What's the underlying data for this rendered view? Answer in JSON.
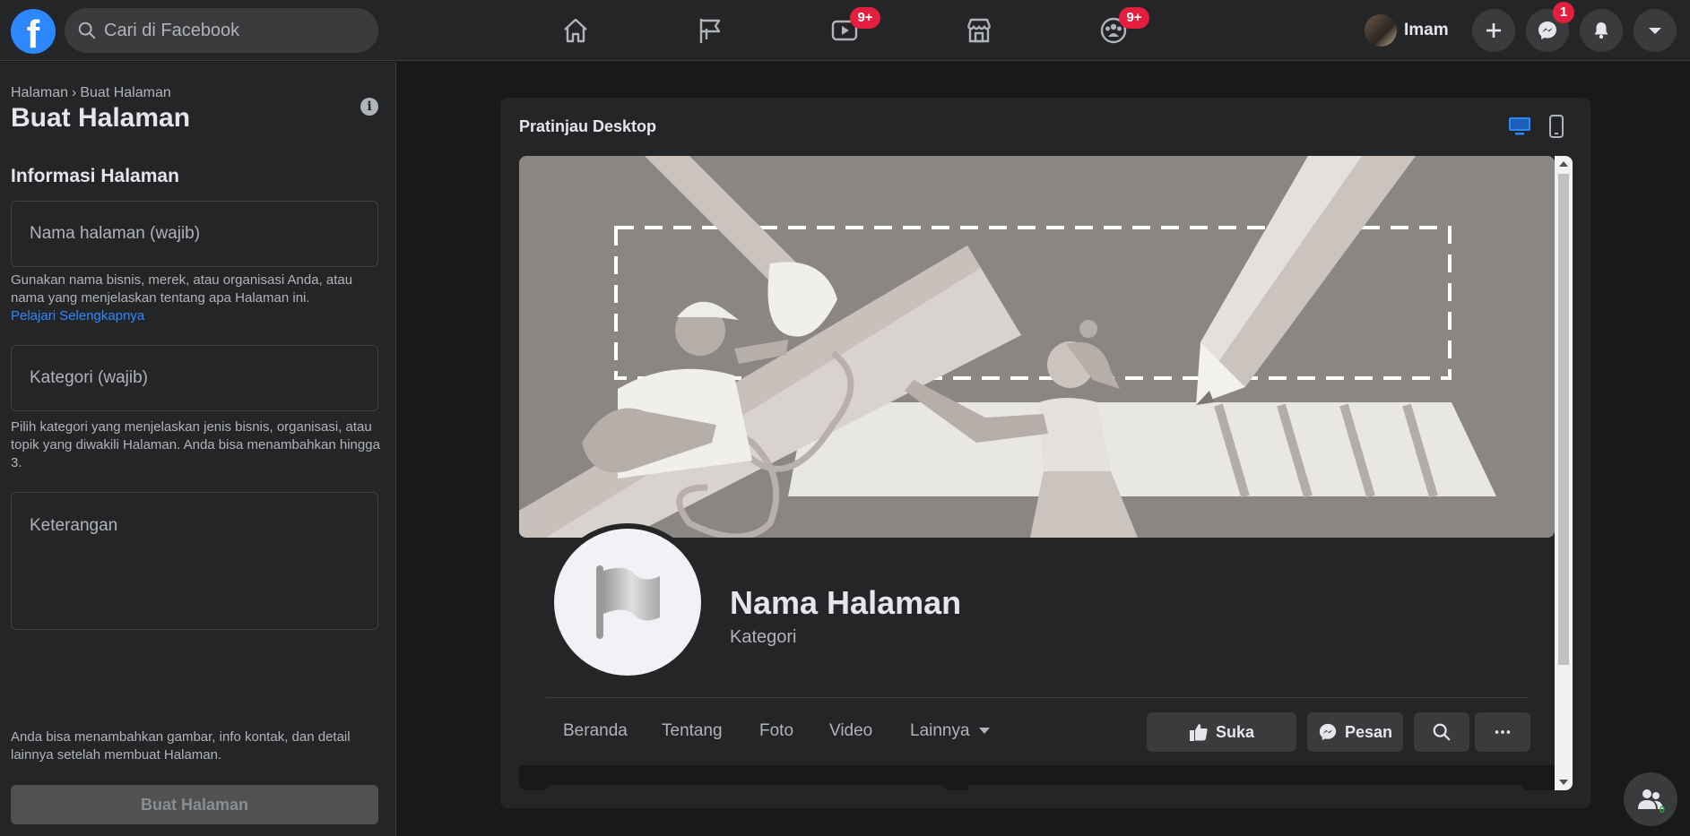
{
  "topbar": {
    "search_placeholder": "Cari di Facebook",
    "nav": [
      {
        "icon": "home-icon",
        "badge": ""
      },
      {
        "icon": "flag-icon",
        "badge": ""
      },
      {
        "icon": "watch-icon",
        "badge": "9+"
      },
      {
        "icon": "marketplace-icon",
        "badge": ""
      },
      {
        "icon": "groups-icon",
        "badge": "9+"
      }
    ],
    "profile_name": "Imam",
    "messenger_badge": "1"
  },
  "left_panel": {
    "breadcrumb_parent": "Halaman",
    "breadcrumb_separator": "›",
    "breadcrumb_current": "Buat Halaman",
    "title": "Buat Halaman",
    "section_title": "Informasi Halaman",
    "name_placeholder": "Nama halaman (wajib)",
    "name_help": "Gunakan nama bisnis, merek, atau organisasi Anda, atau nama yang menjelaskan tentang apa Halaman ini.",
    "learn_more": "Pelajari Selengkapnya",
    "category_placeholder": "Kategori (wajib)",
    "category_help": "Pilih kategori yang menjelaskan jenis bisnis, organisasi, atau topik yang diwakili Halaman. Anda bisa menambahkan hingga 3.",
    "description_placeholder": "Keterangan",
    "footer_note": "Anda bisa menambahkan gambar, info kontak, dan detail lainnya setelah membuat Halaman.",
    "create_button": "Buat Halaman"
  },
  "preview": {
    "title": "Pratinjau Desktop",
    "active_view": "desktop",
    "accent_color": "#2d88ff",
    "page_name": "Nama Halaman",
    "page_category": "Kategori",
    "tabs": [
      "Beranda",
      "Tentang",
      "Foto",
      "Video",
      "Lainnya"
    ],
    "like_button": "Suka",
    "message_button": "Pesan",
    "search_button_icon": "search-icon",
    "more_button_icon": "more-icon"
  },
  "contacts_count": "0"
}
